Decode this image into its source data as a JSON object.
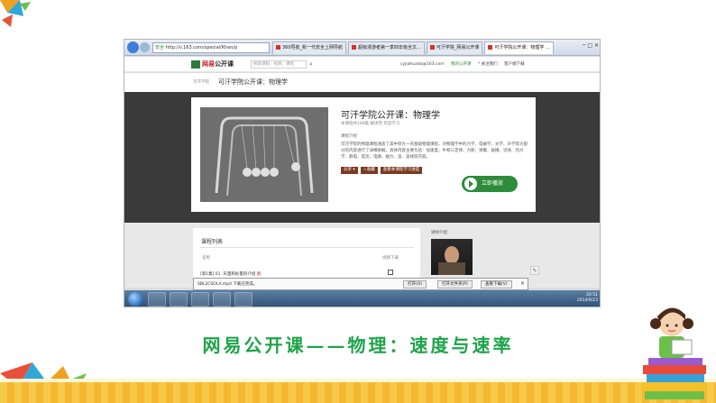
{
  "browser": {
    "address": "http://v.163.com/special/Khan/p",
    "address_prefix": "安全",
    "tabs": [
      {
        "label": "360导航_新一代安全上网导航",
        "active": false
      },
      {
        "label": "超级漫游者第一季四年级全文...",
        "active": false
      },
      {
        "label": "可汗学院_网易公开课",
        "active": false
      },
      {
        "label": "可汗学院公开课：物理学 ...",
        "active": true
      }
    ],
    "window_controls": "─ □ ✕"
  },
  "site": {
    "logo_red": "网易",
    "logo_rest": "公开课",
    "search_placeholder": "搜索课程、视频、课程",
    "search_icon": "search-icon",
    "user": "cyjiahuada@163.com",
    "my_courses": "我的公开课",
    "follow": "* 关注我们",
    "app": "客户端下载"
  },
  "breadcrumb": {
    "small": "可汗学院",
    "title": "可汗学院公开课：物理学"
  },
  "course": {
    "title": "可汗学院公开课：物理学",
    "meta": "本课程共168集 翻译完 欢迎学习",
    "intro_label": "课程介绍",
    "description": "可汗学院的物理课程涵盖了高中到大一的基础物理课程，对物理学中的力学、电磁学、光学、声学等大部分的内容进行了详细讲解。具体内容主要包括：加速度、牛顿三定律、力矩、弹簧、碰撞、流体、热力学、静电、电流、电路、磁力、波、波线等内容。",
    "buttons": [
      "分享 ▾",
      "☆收藏",
      "查看本课程学习进度"
    ],
    "play_label": "立即播放"
  },
  "course_list": {
    "title": "课程列表",
    "col_name": "名称",
    "col_download": "视频下载",
    "row_label": "[第1集] 01. 矢量和标量的介绍",
    "row_badge": "翻"
  },
  "teacher": {
    "label": "讲师介绍"
  },
  "download_bar": {
    "text": "SBL2CSOLA.mp4 下载已完成。",
    "open": "打开(O)",
    "open_folder": "打开文件夹(P)",
    "view_downloads": "查看下载(V)",
    "close": "✕"
  },
  "taskbar": {
    "time": "20:51",
    "date": "2014/9/23"
  },
  "caption": "网易公开课——物理：速度与速率"
}
